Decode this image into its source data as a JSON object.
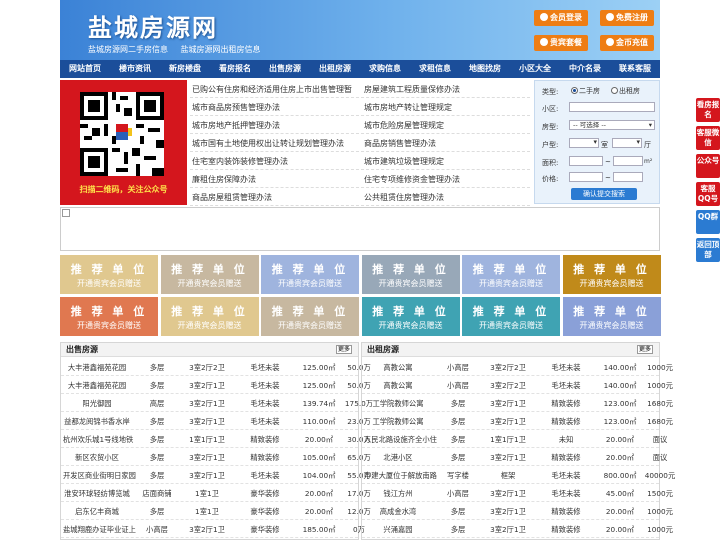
{
  "header": {
    "title": "盐城房源网",
    "sub1": "盐城房源网二手房信息",
    "sub2": "盐城房源网出租房信息",
    "buttons": [
      "会员登录",
      "免费注册",
      "贵宾套餐",
      "金币充值"
    ]
  },
  "nav": [
    "网站首页",
    "楼市资讯",
    "新房楼盘",
    "看房报名",
    "出售房源",
    "出租房源",
    "求购信息",
    "求租信息",
    "地图找房",
    "小区大全",
    "中介名录",
    "联系客服"
  ],
  "qr_caption": "扫描二维码，关注公众号",
  "links_left": [
    "已购公有住房和经济适用住房上市出售管理暂",
    "城市商品房预售管理办法",
    "城市房地产抵押管理办法",
    "城市国有土地使用权出让转让规划管理办法",
    "住宅室内装饰装修管理办法",
    "廉租住房保障办法",
    "商品房屋租赁管理办法"
  ],
  "links_right": [
    "房屋建筑工程质量保修办法",
    "城市房地产转让管理规定",
    "城市危险房屋管理规定",
    "商品房销售管理办法",
    "城市建筑垃圾管理规定",
    "住宅专项维修资金管理办法",
    "公共租赁住房管理办法"
  ],
  "search": {
    "type_label": "类型:",
    "opt1": "二手房",
    "opt2": "出租房",
    "community_label": "小区:",
    "house_label": "房型:",
    "house_select": "-- 可选择 --",
    "layout_label": "户型:",
    "room_unit": "室",
    "hall_unit": "厅",
    "area_label": "面积:",
    "area_unit": "m²",
    "price_label": "价格:",
    "tilde": "~",
    "submit": "确认提交搜索"
  },
  "tiles": {
    "line1": "推 荐 单 位",
    "line2": "开通贵宾会员赠送",
    "colors": [
      "#e0c88f",
      "#c7b8a0",
      "#9fb4de",
      "#98a8b8",
      "#9fb4de",
      "#c08a1a",
      "#e07850",
      "#e0c88f",
      "#c7b8a0",
      "#3fa3b3",
      "#3fa3b3",
      "#8aa0d8"
    ]
  },
  "sale": {
    "title": "出售房源",
    "more": "更多",
    "rows": [
      [
        "大丰港鑫福苑花园",
        "多层",
        "3室2厅2卫",
        "毛坯未装",
        "125.00㎡",
        "50.0万"
      ],
      [
        "大丰港鑫福苑花园",
        "多层",
        "3室2厅1卫",
        "毛坯未装",
        "125.00㎡",
        "50.0万"
      ],
      [
        "阳光御园",
        "高层",
        "3室2厅1卫",
        "毛坯未装",
        "139.74㎡",
        "175.0万"
      ],
      [
        "益都龙阅锦书香水岸",
        "多层",
        "3室2厅1卫",
        "毛坯未装",
        "110.00㎡",
        "23.0万"
      ],
      [
        "杭州欢乐城1号线地铁",
        "多层",
        "1室1厅1卫",
        "精致装修",
        "20.00㎡",
        "30.0万"
      ],
      [
        "新区农贸小区",
        "多层",
        "3室2厅1卫",
        "精致装修",
        "105.00㎡",
        "65.0万"
      ],
      [
        "开发区商业街明日家园",
        "多层",
        "3室2厅1卫",
        "毛坯未装",
        "104.00㎡",
        "55.0万"
      ],
      [
        "淮安环球轻纺博览城",
        "店面商铺",
        "1室1卫",
        "豪华装修",
        "20.00㎡",
        "17.0万"
      ],
      [
        "启东亿丰商城",
        "多层",
        "1室1卫",
        "豪华装修",
        "20.00㎡",
        "12.0万"
      ],
      [
        "盐城翔鹿办证毕业证上",
        "小高层",
        "3室2厅1卫",
        "豪华装修",
        "185.00㎡",
        "0万"
      ]
    ]
  },
  "rent": {
    "title": "出租房源",
    "more": "更多",
    "rows": [
      [
        "高教公寓",
        "小高层",
        "3室2厅2卫",
        "毛坯未装",
        "140.00㎡",
        "1000元"
      ],
      [
        "高教公寓",
        "小高层",
        "3室2厅2卫",
        "毛坯未装",
        "140.00㎡",
        "1000元"
      ],
      [
        "工学院教师公寓",
        "多层",
        "3室2厅1卫",
        "精致装修",
        "123.00㎡",
        "1680元"
      ],
      [
        "工学院教师公寓",
        "多层",
        "3室2厅1卫",
        "精致装修",
        "123.00㎡",
        "1680元"
      ],
      [
        "人民北路设施齐全小住",
        "多层",
        "1室1厅1卫",
        "未知",
        "20.00㎡",
        "面议"
      ],
      [
        "北港小区",
        "多层",
        "3室2厅1卫",
        "精致装修",
        "20.00㎡",
        "面议"
      ],
      [
        "中建大厦位于解放南路",
        "写字楼",
        "框架",
        "毛坯未装",
        "800.00㎡",
        "40000元"
      ],
      [
        "钱江方州",
        "小高层",
        "3室2厅1卫",
        "毛坯未装",
        "45.00㎡",
        "1500元"
      ],
      [
        "高成金水湾",
        "多层",
        "3室2厅1卫",
        "精致装修",
        "20.00㎡",
        "1000元"
      ],
      [
        "兴涌嘉园",
        "多层",
        "3室2厅1卫",
        "精致装修",
        "20.00㎡",
        "1000元"
      ]
    ]
  },
  "sidebar": [
    "看房报名",
    "客服微信",
    "公众号",
    "客服QQ号",
    "QQ群",
    "返回顶部"
  ]
}
